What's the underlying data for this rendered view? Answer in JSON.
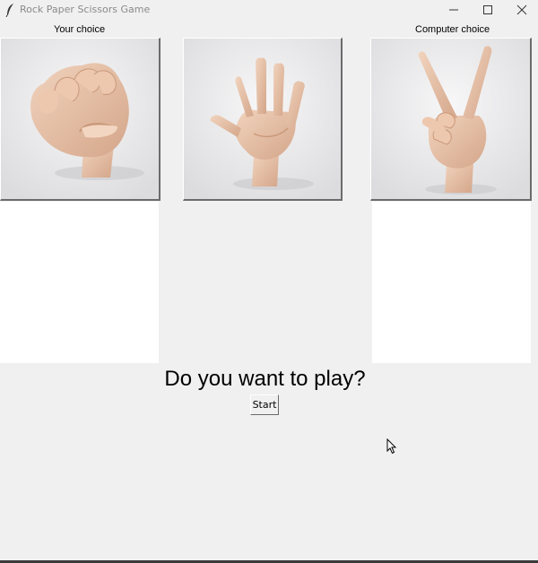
{
  "window": {
    "title": "Rock Paper Scissors Game",
    "controls": [
      "minimize-icon",
      "maximize-icon",
      "close-icon"
    ]
  },
  "labels": {
    "your_choice": "Your choice",
    "computer_choice": "Computer choice"
  },
  "choices": [
    {
      "name": "rock",
      "icon": "fist-hand-image"
    },
    {
      "name": "paper",
      "icon": "open-hand-image"
    },
    {
      "name": "scissors",
      "icon": "peace-sign-hand-image"
    }
  ],
  "prompt": "Do you want to play?",
  "start_button": "Start",
  "colors": {
    "window_bg": "#f0f0f0",
    "panel_bg": "#ffffff",
    "skin": "#e8c2a8",
    "title_text": "#8a8a8a"
  }
}
